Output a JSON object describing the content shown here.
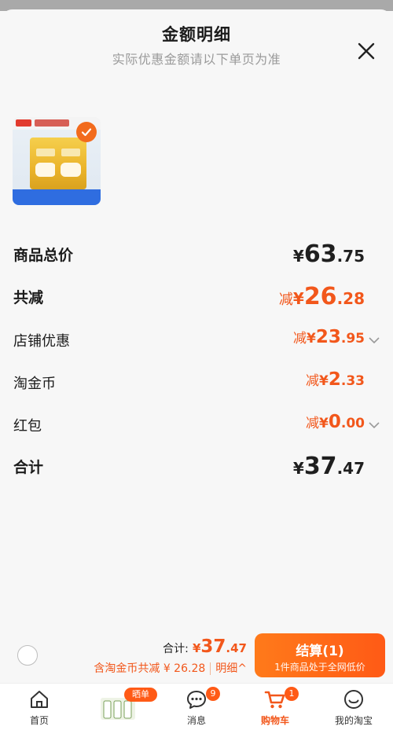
{
  "sheet": {
    "title": "金额明细",
    "subtitle": "实际优惠金额请以下单页为准"
  },
  "product": {
    "selected": true
  },
  "rows": [
    {
      "label": "商品总价",
      "prefix": "",
      "yen": "¥",
      "int": "63",
      "dec": ".75"
    },
    {
      "label": "共减",
      "prefix": "减",
      "yen": "¥",
      "int": "26",
      "dec": ".28"
    },
    {
      "label": "店铺优惠",
      "prefix": "减",
      "yen": "¥",
      "int": "23",
      "dec": ".95"
    },
    {
      "label": "淘金币",
      "prefix": "减",
      "yen": "¥",
      "int": "2",
      "dec": ".33"
    },
    {
      "label": "红包",
      "prefix": "减",
      "yen": "¥",
      "int": "0",
      "dec": ".00"
    },
    {
      "label": "合计",
      "prefix": "",
      "yen": "¥",
      "int": "37",
      "dec": ".47"
    }
  ],
  "footer": {
    "total_label": "合计:",
    "total_yen": "¥",
    "total_int": "37",
    "total_dec": ".47",
    "savings_text": "含淘金币共减 ¥ 26.28",
    "detail_label": "明细^",
    "checkout_label": "结算(1)",
    "checkout_sub": "1件商品处于全网低价"
  },
  "tabbar": {
    "home": "首页",
    "promo_tag": "晒单+1",
    "messages": "消息",
    "messages_badge": "9",
    "cart": "购物车",
    "cart_badge": "1",
    "mine": "我的淘宝"
  },
  "colors": {
    "accent": "#f2571b",
    "checkout": "#ff6a16",
    "text": "#1f1f1f",
    "muted": "#9a9a9a"
  }
}
